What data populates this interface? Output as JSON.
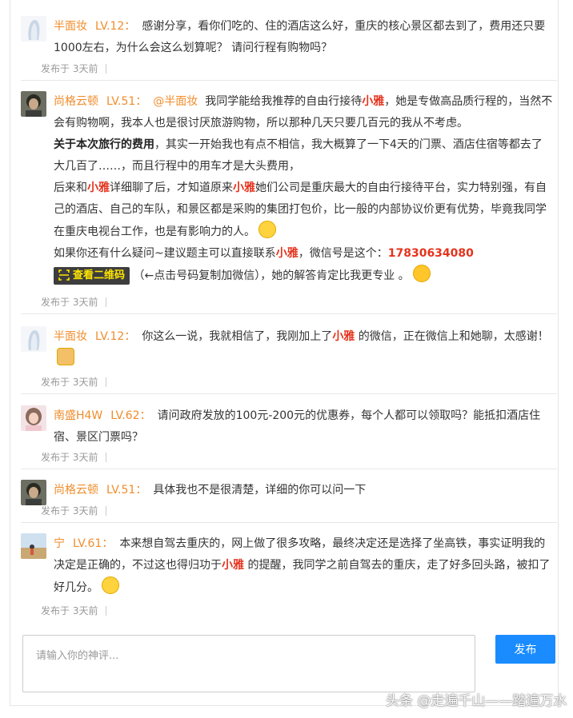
{
  "comments": [
    {
      "name": "半面妆",
      "level": "LV.12",
      "text": "感谢分享，看你们吃的、住的酒店这么好，重庆的核心景区都去到了，费用还只要1000左右，为什么会这么划算呢？ 请问行程有购物吗？",
      "time": "发布于 3天前"
    },
    {
      "name": "尚格云顿",
      "level": "LV.51",
      "mention": "@半面妆",
      "p1a": "我同学能给我推荐的自由行接待",
      "xiaoya": "小雅",
      "p1b": "，她是专做高品质行程的，当然不会有购物啊，我本人也是很讨厌旅游购物，所以那种几天只要几百元的我从不考虑。",
      "p2bold": "关于本次旅行的费用",
      "p2": "，其实一开始我也有点不相信，我大概算了一下4天的门票、酒店住宿等都去了大几百了……，而且行程中的用车才是大头费用，",
      "p3a": "后来和",
      "p3b": "详细聊了后，才知道原来",
      "p3c": "她们公司是重庆最大的自由行接待平台，实力特别强，有自己的酒店、自己的车队，和景区都是采购的集团打包价，比一般的内部协议价更有优势，毕竟我同学在重庆电视台工作，也是有影响力的人。",
      "p4a": "如果你还有什么疑问~建议题主可以直接联系",
      "p4b": "，微信号是这个：",
      "phone": "17830634080",
      "qr_label": "查看二维码",
      "p5": "（←点击号码复制加微信），她的解答肯定比我更专业 。",
      "time": "发布于 3天前"
    },
    {
      "name": "半面妆",
      "level": "LV.12",
      "ta": "你这么一说，我就相信了，我刚加上了",
      "xiaoya": "小雅",
      "tb": " 的微信，正在微信上和她聊，太感谢！",
      "time": "发布于 3天前"
    },
    {
      "name": "南盛H4W",
      "level": "LV.62",
      "text": "请问政府发放的100元-200元的优惠券，每个人都可以领取吗？能抵扣酒店住宿、景区门票吗？",
      "time": "发布于 3天前"
    },
    {
      "name": "尚格云顿",
      "level": "LV.51",
      "text": "具体我也不是很清楚，详细的你可以问一下",
      "time": "发布于 3天前"
    },
    {
      "name": "宁",
      "level": "LV.61",
      "ta": "本来想自驾去重庆的，网上做了很多攻略，最终决定还是选择了坐高铁，事实证明我的决定是正确的，不过这也得归功于",
      "xiaoya": "小雅",
      "tb": " 的提醒，我同学之前自驾去的重庆，走了好多回头路，被扣了好几分。",
      "time": "发布于 3天前"
    }
  ],
  "colon": "：",
  "input": {
    "placeholder": "请输入你的神评..."
  },
  "submit_label": "发布",
  "watermark": "头条 @走遍千山——踏遍万水",
  "colors": {
    "name": "#f08d2c",
    "highlight": "#e5331d",
    "button": "#1a8cff",
    "qr_bg": "#3d3d3d",
    "qr_text": "#ffe600"
  },
  "icons": [
    "grin-emoji-icon",
    "cool-emoji-icon",
    "clap-emoji-icon",
    "thinking-emoji-icon",
    "qr-scan-icon"
  ]
}
